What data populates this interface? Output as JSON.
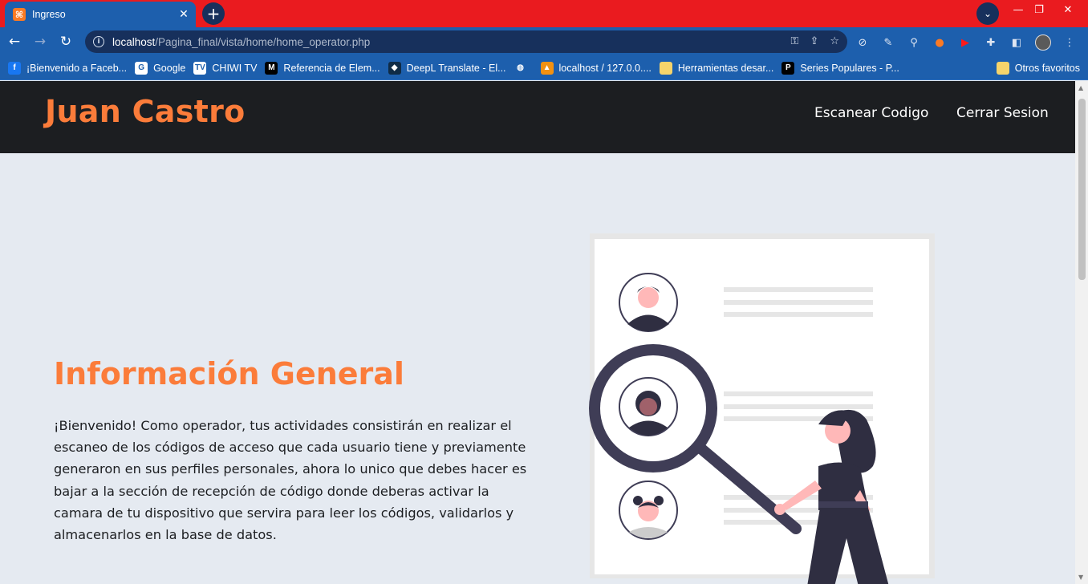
{
  "browser": {
    "tab_title": "Ingreso",
    "tab_favicon": "xampp-icon",
    "url_host": "localhost",
    "url_path": "/Pagina_final/vista/home/home_operator.php",
    "bookmarks": [
      {
        "label": "¡Bienvenido a Faceb...",
        "icon": "facebook-icon",
        "color": "#1877f2",
        "glyph": "f"
      },
      {
        "label": "Google",
        "icon": "google-icon",
        "color": "#ffffff",
        "glyph": "G"
      },
      {
        "label": "CHIWI TV",
        "icon": "tv-icon",
        "color": "#ffffff",
        "glyph": "TV"
      },
      {
        "label": "Referencia de Elem...",
        "icon": "mdn-icon",
        "color": "#000000",
        "glyph": "M"
      },
      {
        "label": "DeepL Translate - El...",
        "icon": "deepl-icon",
        "color": "#0f2b46",
        "glyph": "◆"
      },
      {
        "label": "",
        "icon": "globe-icon",
        "color": "#1d5fad",
        "glyph": "◍"
      },
      {
        "label": "localhost / 127.0.0....",
        "icon": "phpmyadmin-icon",
        "color": "#f29111",
        "glyph": "▲"
      },
      {
        "label": "Herramientas desar...",
        "icon": "folder-icon",
        "color": "#f6d46b",
        "glyph": ""
      },
      {
        "label": "Series Populares - P...",
        "icon": "p-icon",
        "color": "#000000",
        "glyph": "P"
      }
    ],
    "other_bookmarks": "Otros favoritos"
  },
  "site": {
    "brand": "Juan Castro",
    "nav": [
      "Escanear Codigo",
      "Cerrar Sesion"
    ]
  },
  "content": {
    "title": "Información General",
    "paragraph": "¡Bienvenido! Como operador, tus actividades consistirán en realizar el escaneo de los códigos de acceso que cada usuario tiene y previamente generaron en sus perfiles personales, ahora lo unico que debes hacer es bajar a la sección de recepción de código donde deberas activar la camara de tu dispositivo que servira para leer los códigos, validarlos y almacenarlos en la base de datos."
  },
  "colors": {
    "accent": "#fb7c3a",
    "header_bg": "#1c1e21",
    "page_bg": "#e5eaf1",
    "chrome_red": "#ea1b1f",
    "chrome_blue": "#1d5fad"
  }
}
